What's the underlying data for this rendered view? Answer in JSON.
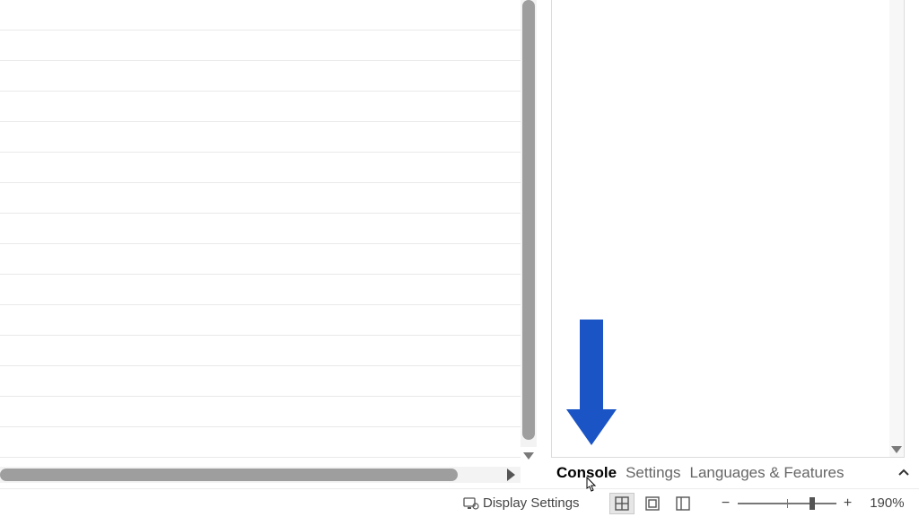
{
  "tabs": {
    "console": "Console",
    "settings": "Settings",
    "languages": "Languages & Features"
  },
  "statusbar": {
    "display_settings": "Display Settings",
    "zoom_minus": "−",
    "zoom_plus": "+",
    "zoom_pct": "190%"
  }
}
